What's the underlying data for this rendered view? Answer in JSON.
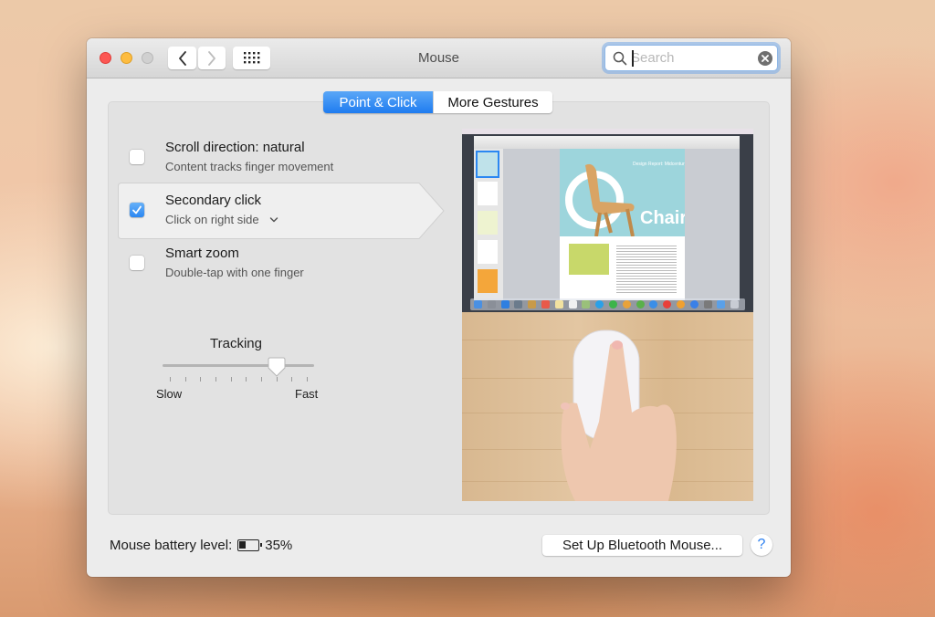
{
  "window": {
    "title": "Mouse",
    "controls": {
      "close": "close-window",
      "minimize": "minimize-window",
      "zoom": "zoom-window-disabled"
    },
    "nav": {
      "back_icon": "chevron-left-icon",
      "forward_icon": "chevron-right-icon",
      "show_all_icon": "grid-icon"
    }
  },
  "search": {
    "placeholder": "Search",
    "value": "",
    "icon": "search-icon",
    "clear_icon": "clear-icon"
  },
  "tabs": [
    {
      "label": "Point & Click",
      "active": true
    },
    {
      "label": "More Gestures",
      "active": false
    }
  ],
  "options": [
    {
      "title": "Scroll direction: natural",
      "subtitle": "Content tracks finger movement",
      "checked": false,
      "selected": false
    },
    {
      "title": "Secondary click",
      "subtitle": "Click on right side",
      "checked": true,
      "selected": true,
      "has_dropdown": true
    },
    {
      "title": "Smart zoom",
      "subtitle": "Double-tap with one finger",
      "checked": false,
      "selected": false
    }
  ],
  "tracking": {
    "label": "Tracking",
    "min_label": "Slow",
    "max_label": "Fast",
    "tick_count": 10,
    "value_fraction": 0.78
  },
  "preview": {
    "description": "Video preview: Pages document 'Design Report: Midcentury Icons' with chair image above a hand right-clicking a Magic Mouse",
    "document_heading": "Design Report: Midcentury Icons",
    "document_hero_text": "Chairs"
  },
  "footer": {
    "battery_label": "Mouse battery level:",
    "battery_percent": "35%",
    "battery_level": 0.35,
    "setup_button": "Set Up Bluetooth Mouse...",
    "help_button": "?"
  },
  "colors": {
    "accent": "#1f7cf0",
    "close": "#fc5753",
    "minimize": "#fdbc40",
    "zoom_disabled": "#d0d0d0"
  }
}
